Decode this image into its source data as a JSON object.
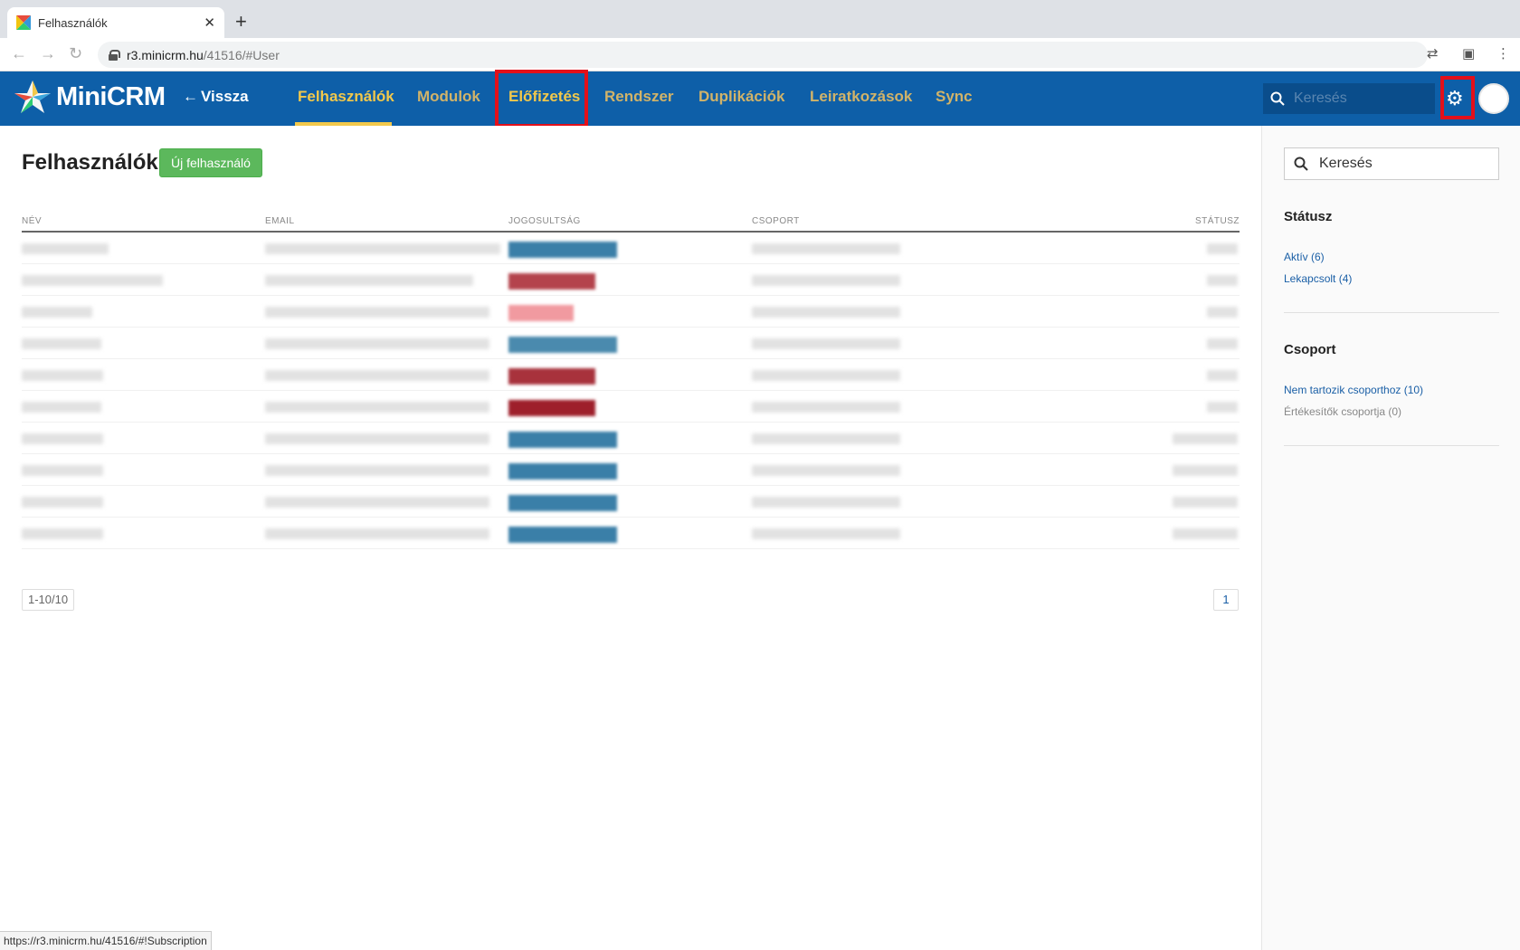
{
  "browser": {
    "tab_title": "Felhasználók",
    "tab_close": "✕",
    "new_tab": "+",
    "url_host": "r3.minicrm.hu",
    "url_path": "/41516/#User",
    "status_url": "https://r3.minicrm.hu/41516/#!Subscription"
  },
  "header": {
    "logo_text": "MiniCRM",
    "back_label": "Vissza",
    "nav": [
      "Felhasználók",
      "Modulok",
      "Előfizetés",
      "Rendszer",
      "Duplikációk",
      "Leiratkozások",
      "Sync"
    ],
    "search_placeholder": "Keresés",
    "highlight_color": "#e3101a"
  },
  "main": {
    "title": "Felhasználók",
    "new_user_button": "Új felhasználó",
    "columns": [
      "NÉV",
      "EMAIL",
      "JOGOSULTSÁG",
      "CSOPORT",
      "STÁTUSZ"
    ],
    "rows": [
      {
        "role_color": "#3a7fa8"
      },
      {
        "role_color": "#b4434c"
      },
      {
        "role_color": "#f19aa0"
      },
      {
        "role_color": "#4a8aae"
      },
      {
        "role_color": "#a8323c"
      },
      {
        "role_color": "#9e1f2b"
      },
      {
        "role_color": "#3a7fa8"
      },
      {
        "role_color": "#3a7fa8"
      },
      {
        "role_color": "#3a7fa8"
      },
      {
        "role_color": "#3a7fa8"
      }
    ],
    "pager_count": "1-10/10",
    "pager_page": "1"
  },
  "sidebar": {
    "search_placeholder": "Keresés",
    "status_heading": "Státusz",
    "status_items": [
      "Aktív (6)",
      "Lekapcsolt (4)"
    ],
    "group_heading": "Csoport",
    "group_items": [
      "Nem tartozik csoporthoz (10)",
      "Értékesítők csoportja (0)"
    ]
  },
  "colors": {
    "header_bg": "#0e5fa8",
    "nav_active": "#f2c84b",
    "button_green": "#5cb85c",
    "link": "#1a5fa6"
  }
}
